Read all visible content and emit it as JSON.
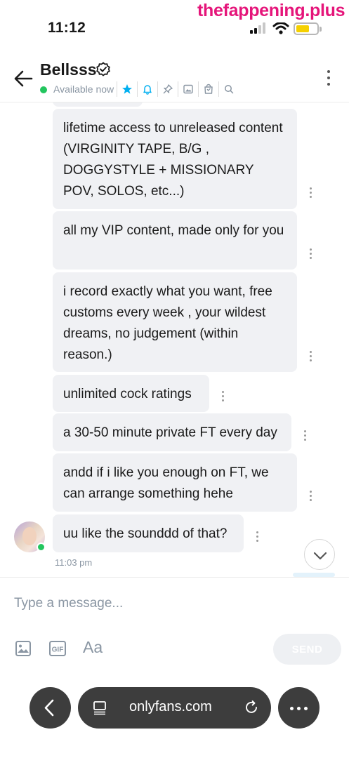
{
  "status_bar": {
    "time": "11:12"
  },
  "watermark": "thefappening.plus",
  "header": {
    "name": "Bellsss",
    "status": "Available now",
    "icons": [
      "star-icon",
      "bell-icon",
      "pin-icon",
      "image-icon",
      "shopping-bag-icon",
      "search-icon"
    ]
  },
  "messages": [
    {
      "text": "lifetime access to unreleased content (VIRGINITY TAPE, B/G , DOGGYSTYLE + MISSIONARY POV, SOLOS, etc...)"
    },
    {
      "text": "all my VIP content, made only for you"
    },
    {
      "text": "i record exactly what you want, free customs every week , your wildest dreams, no judgement (within reason.)"
    },
    {
      "text": "unlimited cock ratings"
    },
    {
      "text": "a 30-50 minute private FT every day"
    },
    {
      "text": "andd if i like you enough on FT, we can arrange something hehe"
    },
    {
      "text": "uu like the sounddd of that?"
    }
  ],
  "last_message_time": "11:03 pm",
  "composer": {
    "placeholder": "Type a message...",
    "text_format_label": "Aa",
    "send_label": "SEND"
  },
  "browser": {
    "url": "onlyfans.com"
  },
  "colors": {
    "accent": "#00aff0",
    "online": "#22c55e",
    "bubble": "#f0f1f4",
    "muted": "#8a96a3"
  }
}
